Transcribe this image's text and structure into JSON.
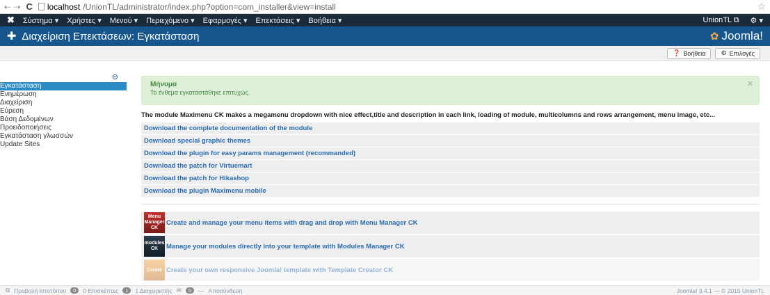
{
  "browser": {
    "host": "localhost",
    "path": "/UnionTL/administrator/index.php?option=com_installer&view=install"
  },
  "navbar": {
    "menu": [
      "Σύστημα ▾",
      "Χρήστες ▾",
      "Μενού ▾",
      "Περιεχόμενο ▾",
      "Εφαρμογές ▾",
      "Επεκτάσεις ▾",
      "Βοήθεια ▾"
    ],
    "user": "UnionTL ⧉",
    "settings": "⚙ ▾"
  },
  "title": {
    "text": "Διαχείριση Επεκτάσεων: Εγκατάσταση",
    "brand": "Joomla!"
  },
  "toolbar": {
    "help_label": "Βοήθεια",
    "options_label": "Επιλογές"
  },
  "sidebar": {
    "items": [
      {
        "label": "Εγκατάσταση"
      },
      {
        "label": "Ενημέρωση"
      },
      {
        "label": "Διαχείριση"
      },
      {
        "label": "Εύρεση"
      },
      {
        "label": "Βάση Δεδομένων"
      },
      {
        "label": "Προειδοποιήσεις"
      },
      {
        "label": "Εγκατάσταση γλωσσών"
      },
      {
        "label": "Update Sites"
      }
    ]
  },
  "alert": {
    "heading": "Μήνυμα",
    "message": "Το ένθεμα εγκαταστάθηκε επιτυχώς."
  },
  "description": "The module Maximenu CK makes a megamenu dropdown with nice effect,title and description in each link, loading of module, multicolumns and rows arrangement, menu image, etc...",
  "links": [
    "Download the complete documentation of the module",
    "Download special graphic themes",
    "Download the plugin for easy params management (recommanded)",
    "Download the patch for Virtuemart",
    "Download the patch for Hikashop",
    "Download the plugin Maximenu mobile"
  ],
  "promos": [
    {
      "thumb": "Menu Manager CK",
      "text": "Create and manage your menu items with drag and drop with Menu Manager CK"
    },
    {
      "thumb": "modules CK",
      "text": "Manage your modules directly into your template with Modules Manager CK"
    },
    {
      "thumb": "Create",
      "text": "Create your own responsive Joomla! template with Template Creator CK"
    }
  ],
  "statusbar": {
    "view_site": "Προβολή Ιστοτόπου",
    "visitors_count": "0",
    "visitors_label": "0 Επισκέπτες",
    "admins_count": "1",
    "admins_label": "1 Διαχειριστής",
    "messages_count": "0",
    "logout": "Αποσύνδεση",
    "version": "Joomla! 3.4.1 — © 2015 UnionTL"
  }
}
